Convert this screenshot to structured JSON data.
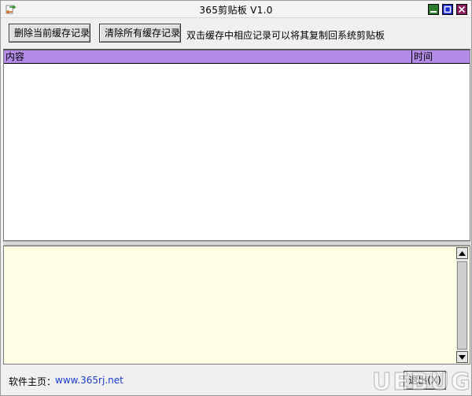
{
  "window": {
    "title": "365剪贴板 V1.0"
  },
  "toolbar": {
    "delete_current_label": "删除当前缓存记录",
    "clear_all_label": "清除所有缓存记录",
    "hint": "双击缓存中相应记录可以将其复制回系统剪贴板"
  },
  "list": {
    "columns": [
      "内容",
      "时间"
    ],
    "header_color": "#b48ce8",
    "rows": []
  },
  "detail": {
    "background_color": "#ffffe6",
    "text": ""
  },
  "status": {
    "home_label": "软件主页：",
    "home_url": "www.365rj.net",
    "exit_label": "退出(X)"
  },
  "watermark": {
    "text": "UEBUG"
  }
}
